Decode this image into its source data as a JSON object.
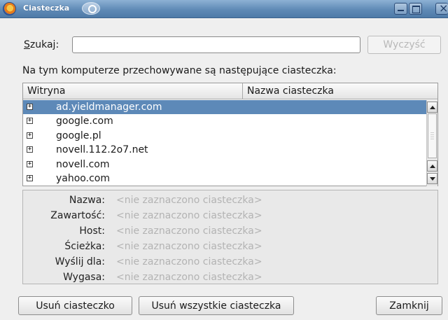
{
  "window": {
    "title": "Ciasteczka"
  },
  "search": {
    "label_accel": "S",
    "label_rest": "zukaj:",
    "value": "",
    "placeholder": "",
    "clear_label": "Wyczyść"
  },
  "intro": "Na tym komputerze przechowywane są następujące ciasteczka:",
  "tree": {
    "columns": [
      "Witryna",
      "Nazwa ciasteczka"
    ],
    "expander_glyph": "+",
    "rows": [
      {
        "site": "ad.yieldmanager.com",
        "selected": true
      },
      {
        "site": "google.com",
        "selected": false
      },
      {
        "site": "google.pl",
        "selected": false
      },
      {
        "site": "novell.112.2o7.net",
        "selected": false
      },
      {
        "site": "novell.com",
        "selected": false
      },
      {
        "site": "yahoo.com",
        "selected": false
      }
    ]
  },
  "details": {
    "fields": [
      {
        "label": "Nazwa:",
        "value": "<nie zaznaczono ciasteczka>"
      },
      {
        "label": "Zawartość:",
        "value": "<nie zaznaczono ciasteczka>"
      },
      {
        "label": "Host:",
        "value": "<nie zaznaczono ciasteczka>"
      },
      {
        "label": "Ścieżka:",
        "value": "<nie zaznaczono ciasteczka>"
      },
      {
        "label": "Wyślij dla:",
        "value": "<nie zaznaczono ciasteczka>"
      },
      {
        "label": "Wygasa:",
        "value": "<nie zaznaczono ciasteczka>"
      }
    ]
  },
  "buttons": {
    "remove": "Usuń ciasteczko",
    "remove_all": "Usuń wszystkie ciasteczka",
    "close": "Zamknij"
  },
  "colors": {
    "titlebar": "#5f8ab6",
    "selection": "#5d89b8",
    "placeholder_text": "#b3b3b3"
  },
  "icons": {
    "app": "firefox-icon",
    "title_extra": "cookie-icon",
    "window_controls": [
      "minimize-icon",
      "maximize-icon",
      "close-icon"
    ],
    "tree_expander": "expand-plus-icon"
  }
}
